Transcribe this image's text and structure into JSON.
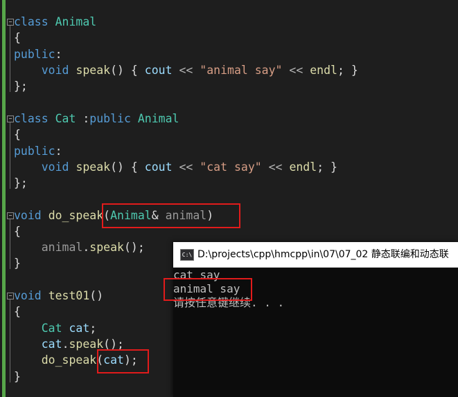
{
  "editor": {
    "lines": [
      [
        {
          "t": "class",
          "c": "kw"
        },
        {
          "t": " "
        },
        {
          "t": "Animal",
          "c": "ty"
        }
      ],
      [
        {
          "t": "{",
          "c": "pl"
        }
      ],
      [
        {
          "t": "public",
          "c": "kw"
        },
        {
          "t": ":",
          "c": "pl"
        }
      ],
      [
        {
          "t": "    "
        },
        {
          "t": "void",
          "c": "kw"
        },
        {
          "t": " "
        },
        {
          "t": "speak",
          "c": "fn"
        },
        {
          "t": "() { ",
          "c": "pl"
        },
        {
          "t": "cout",
          "c": "var"
        },
        {
          "t": " << ",
          "c": "op"
        },
        {
          "t": "\"animal say\"",
          "c": "str"
        },
        {
          "t": " << ",
          "c": "op"
        },
        {
          "t": "endl",
          "c": "fn"
        },
        {
          "t": "; }",
          "c": "pl"
        }
      ],
      [
        {
          "t": "};",
          "c": "pl"
        }
      ],
      [],
      [
        {
          "t": "class",
          "c": "kw"
        },
        {
          "t": " "
        },
        {
          "t": "Cat",
          "c": "ty"
        },
        {
          "t": " :",
          "c": "pl"
        },
        {
          "t": "public",
          "c": "kw"
        },
        {
          "t": " "
        },
        {
          "t": "Animal",
          "c": "ty"
        }
      ],
      [
        {
          "t": "{",
          "c": "pl"
        }
      ],
      [
        {
          "t": "public",
          "c": "kw"
        },
        {
          "t": ":",
          "c": "pl"
        }
      ],
      [
        {
          "t": "    "
        },
        {
          "t": "void",
          "c": "kw"
        },
        {
          "t": " "
        },
        {
          "t": "speak",
          "c": "fn"
        },
        {
          "t": "() { ",
          "c": "pl"
        },
        {
          "t": "cout",
          "c": "var"
        },
        {
          "t": " << ",
          "c": "op"
        },
        {
          "t": "\"cat say\"",
          "c": "str"
        },
        {
          "t": " << ",
          "c": "op"
        },
        {
          "t": "endl",
          "c": "fn"
        },
        {
          "t": "; }",
          "c": "pl"
        }
      ],
      [
        {
          "t": "};",
          "c": "pl"
        }
      ],
      [],
      [
        {
          "t": "void",
          "c": "kw"
        },
        {
          "t": " "
        },
        {
          "t": "do_speak",
          "c": "fn"
        },
        {
          "t": "(",
          "c": "pl"
        },
        {
          "t": "Animal",
          "c": "ty"
        },
        {
          "t": "& ",
          "c": "pl"
        },
        {
          "t": "animal",
          "c": "param"
        },
        {
          "t": ")",
          "c": "pl"
        }
      ],
      [
        {
          "t": "{",
          "c": "pl"
        }
      ],
      [
        {
          "t": "    "
        },
        {
          "t": "animal",
          "c": "param"
        },
        {
          "t": ".",
          "c": "pl"
        },
        {
          "t": "speak",
          "c": "fn"
        },
        {
          "t": "();",
          "c": "pl"
        }
      ],
      [
        {
          "t": "}",
          "c": "pl"
        }
      ],
      [],
      [
        {
          "t": "void",
          "c": "kw"
        },
        {
          "t": " "
        },
        {
          "t": "test01",
          "c": "fn"
        },
        {
          "t": "()",
          "c": "pl"
        }
      ],
      [
        {
          "t": "{",
          "c": "pl"
        }
      ],
      [
        {
          "t": "    "
        },
        {
          "t": "Cat",
          "c": "ty"
        },
        {
          "t": " "
        },
        {
          "t": "cat",
          "c": "var"
        },
        {
          "t": ";",
          "c": "pl"
        }
      ],
      [
        {
          "t": "    "
        },
        {
          "t": "cat",
          "c": "var"
        },
        {
          "t": ".",
          "c": "pl"
        },
        {
          "t": "speak",
          "c": "fn"
        },
        {
          "t": "();",
          "c": "pl"
        }
      ],
      [
        {
          "t": "    "
        },
        {
          "t": "do_speak",
          "c": "fn"
        },
        {
          "t": "(",
          "c": "pl"
        },
        {
          "t": "cat",
          "c": "var"
        },
        {
          "t": ");",
          "c": "pl"
        }
      ],
      [
        {
          "t": "}",
          "c": "pl"
        }
      ]
    ],
    "colors": {
      "background": "#1e1e1e",
      "keyword": "#569cd6",
      "type": "#4ec9b0",
      "function": "#dcdcaa",
      "string": "#d69d85",
      "variable": "#9cdcfe",
      "parameter": "#9a9a9a",
      "highlight_box": "#e21b1b",
      "change_bar": "#57a64a"
    }
  },
  "console": {
    "icon": "C:\\",
    "icon_name": "console-app-icon",
    "title": "D:\\projects\\cpp\\hmcpp\\in\\07\\07_02 静态联编和动态联",
    "output": [
      "cat say",
      "animal say",
      "请按任意键继续. . ."
    ]
  }
}
